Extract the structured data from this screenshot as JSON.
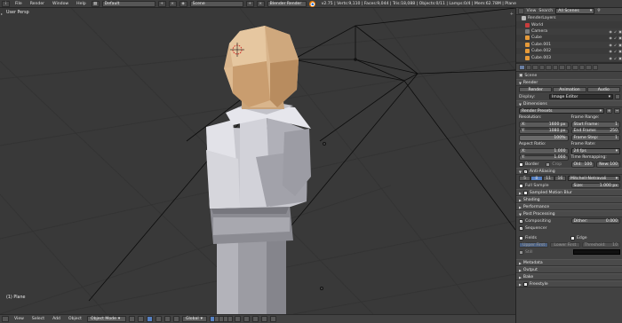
{
  "topbar": {
    "menus": [
      "File",
      "Render",
      "Window",
      "Help"
    ],
    "layout": "Default",
    "scene": "Scene",
    "engine": "Blender Render",
    "stats": "v2.75 | Verts:9,110 | Faces:9,044 | Tris:18,088 | Objects:0/11 | Lamps:0/4 | Mem:62.78M | Plane"
  },
  "viewport": {
    "view_label": "User Persp",
    "object_label": "(1) Plane"
  },
  "footer": {
    "menus": [
      "View",
      "Select",
      "Add",
      "Object"
    ],
    "mode": "Object Mode",
    "pivot": "Global"
  },
  "outliner": {
    "view_label": "View",
    "search_label": "Search",
    "filter": "All Scenes",
    "items": [
      {
        "name": "RenderLayers",
        "color": "#b9b9b9"
      },
      {
        "name": "World",
        "color": "#c93d3d"
      },
      {
        "name": "Camera",
        "color": "#7c7c7c"
      },
      {
        "name": "Cube",
        "color": "#e69a39"
      },
      {
        "name": "Cube.001",
        "color": "#e69a39"
      },
      {
        "name": "Cube.002",
        "color": "#e69a39"
      },
      {
        "name": "Cube.003",
        "color": "#e69a39"
      }
    ]
  },
  "props": {
    "scene_name": "Scene",
    "render_panel": {
      "title": "Render",
      "render_btn": "Render",
      "animation_btn": "Animation",
      "audio_btn": "Audio",
      "display_label": "Display:",
      "display_value": "Image Editor"
    },
    "dimensions_panel": {
      "title": "Dimensions",
      "presets": "Render Presets",
      "resolution_label": "Resolution:",
      "res_x": "1600 px",
      "res_y": "1080 px",
      "res_pct": "100%",
      "frame_range_label": "Frame Range:",
      "start_frame": "1",
      "end_frame": "250",
      "frame_step": "1",
      "aspect_label": "Aspect Ratio:",
      "aspect_x": "1.000",
      "aspect_y": "1.000",
      "frame_rate_label": "Frame Rate:",
      "frame_rate": "24 fps",
      "time_remap_label": "Time Remapping:",
      "old": "100",
      "new": "100",
      "border_label": "Border",
      "crop_label": "Crop",
      "x_label": "X:",
      "y_label": "Y:",
      "start_label": "Start Frame:",
      "end_label": "End Frame:",
      "step_label": "Frame Step:",
      "old_label": "Old:",
      "new_label": "New:"
    },
    "aa_panel": {
      "title": "Anti-Aliasing",
      "samples": [
        "5",
        "8",
        "11",
        "16"
      ],
      "filter": "Mitchell-Netravali",
      "full_sample": "Full Sample",
      "size_label": "Size:",
      "size_value": "1.000 px"
    },
    "collapsed": [
      "Sampled Motion Blur",
      "Shading",
      "Performance"
    ],
    "post_panel": {
      "title": "Post Processing",
      "compositing": "Compositing",
      "sequencer": "Sequencer",
      "dither_label": "Dither:",
      "dither_value": "0.000",
      "fields": "Fields",
      "edge": "Edge",
      "upper_first": "Upper First",
      "lower_first": "Lower First",
      "threshold_label": "Threshold:",
      "threshold_value": "10",
      "still": "Still"
    },
    "tail_panels": [
      "Metadata",
      "Output",
      "Bake",
      "Freestyle"
    ]
  }
}
